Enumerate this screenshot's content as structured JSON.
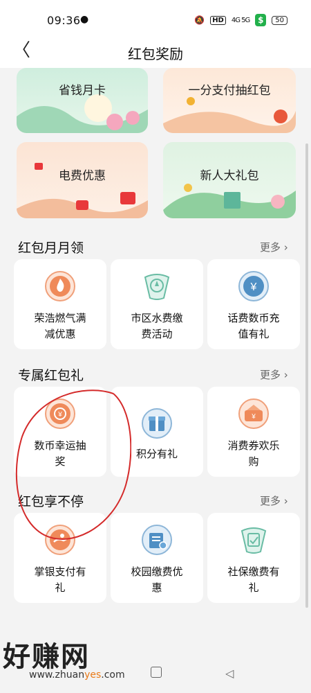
{
  "status": {
    "time": "09:36",
    "network": "4G 5G",
    "hd": "HD",
    "battery": "50"
  },
  "nav": {
    "title": "红包奖励"
  },
  "banners": [
    "省钱月卡",
    "一分支付抽红包",
    "电费优惠",
    "新人大礼包"
  ],
  "sections": [
    {
      "title": "红包月月领",
      "more": "更多",
      "items": [
        {
          "line1": "荣浩燃气满",
          "line2": "减优惠",
          "icon": "flame-icon"
        },
        {
          "line1": "市区水费缴",
          "line2": "费活动",
          "icon": "water-drop-icon"
        },
        {
          "line1": "话费数币充",
          "line2": "值有礼",
          "icon": "digital-yuan-icon"
        }
      ]
    },
    {
      "title": "专属红包礼",
      "more": "更多",
      "items": [
        {
          "line1": "数币幸运抽",
          "line2": "奖",
          "icon": "lottery-coin-icon"
        },
        {
          "line1": "积分有礼",
          "line2": "",
          "icon": "gift-box-icon"
        },
        {
          "line1": "消费券欢乐",
          "line2": "购",
          "icon": "coupon-shop-icon"
        }
      ]
    },
    {
      "title": "红包享不停",
      "more": "更多",
      "items": [
        {
          "line1": "掌银支付有",
          "line2": "礼",
          "icon": "hand-pay-icon"
        },
        {
          "line1": "校园缴费优",
          "line2": "惠",
          "icon": "book-icon"
        },
        {
          "line1": "社保缴费有",
          "line2": "礼",
          "icon": "social-security-icon"
        }
      ]
    }
  ],
  "watermark": {
    "text": "好赚网",
    "url_pre": "www.zhuan",
    "url_hl": "yes",
    "url_post": ".com"
  },
  "colors": {
    "accent": "#e97a18",
    "annotation": "#d42a2a"
  }
}
